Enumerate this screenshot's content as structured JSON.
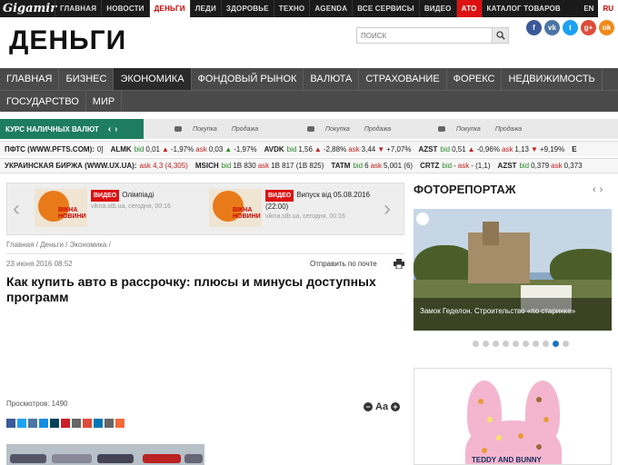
{
  "topbar": {
    "logo": "Gigamir",
    "items": [
      "ГЛАВНАЯ",
      "НОВОСТИ",
      "ДЕНЬГИ",
      "ЛЕДИ",
      "ЗДОРОВЬЕ",
      "ТЕХНО",
      "AGENDA",
      "ВСЕ СЕРВИСЫ",
      "ВИДЕО",
      "АТО",
      "КАТАЛОГ ТОВАРОВ"
    ],
    "active": "ДЕНЬГИ",
    "highlight": "АТО",
    "langs": [
      "EN",
      "RU"
    ],
    "lang_active": "RU"
  },
  "header": {
    "brand": "ДЕНЬГИ",
    "search_placeholder": "ПОИСК",
    "social": [
      {
        "icon": "facebook-icon",
        "glyph": "f",
        "color": "#3b5998"
      },
      {
        "icon": "vk-icon",
        "glyph": "vk",
        "color": "#4c75a3"
      },
      {
        "icon": "twitter-icon",
        "glyph": "t",
        "color": "#1da1f2"
      },
      {
        "icon": "google-plus-icon",
        "glyph": "g+",
        "color": "#dd4b39"
      },
      {
        "icon": "odnoklassniki-icon",
        "glyph": "ok",
        "color": "#f28a1a"
      }
    ]
  },
  "mainnav": {
    "row1": [
      "ГЛАВНАЯ",
      "БИЗНЕС",
      "ЭКОНОМИКА",
      "ФОНДОВЫЙ РЫНОК",
      "ВАЛЮТА",
      "СТРАХОВАНИЕ",
      "ФОРЕКС",
      "НЕДВИЖИМОСТЬ"
    ],
    "row2": [
      "ГОСУДАРСТВО",
      "МИР"
    ],
    "active": "ЭКОНОМИКА"
  },
  "currency": {
    "tab": "КУРС НАЛИЧНЫХ ВАЛЮТ",
    "buy": "Покупка",
    "sell": "Продажа"
  },
  "ticker1": {
    "source": "ПФТС (WWW.PFTS.COM):",
    "lead": "0]",
    "items": [
      {
        "t": "ALMK",
        "bid": "0,01",
        "bidch": "-1,97%",
        "ask": "0,03",
        "askch": "-1,97%"
      },
      {
        "t": "AVDK",
        "bid": "1,56",
        "bidch": "-2,88%",
        "ask": "3,44",
        "askch": "+7,07%"
      },
      {
        "t": "AZST",
        "bid": "0,51",
        "bidch": "-0,96%",
        "ask": "1,13",
        "askch": "+9,19%"
      }
    ],
    "tail": "E"
  },
  "ticker2": {
    "source": "УКРАИНСКАЯ БИРЖА (WWW.UX.UA):",
    "lead_ask": "ask 4,3 (4,305)",
    "items": [
      {
        "t": "MSICH",
        "bid": "1B 830",
        "ask": "1B 817 (1B 825)"
      },
      {
        "t": "TATM",
        "bid": "6",
        "ask": "5,001 (6)"
      },
      {
        "t": "CRTZ",
        "bid": "-",
        "ask": "- (1,1)"
      },
      {
        "t": "AZST",
        "bid": "0,379",
        "ask": "0,373"
      }
    ],
    "bid_label": "bid",
    "ask_label": "ask"
  },
  "video": {
    "tag": "ВИДЕО",
    "thumb_label": "ВІКНА НОВИНИ",
    "items": [
      {
        "title": "Олімпіаді",
        "source": "vikna.stb.ua, сегодня, 00:16"
      },
      {
        "title": "Випуск від 05.08.2016 (22:00)",
        "source": "vikna.stb.ua, сегодня, 00:16"
      }
    ]
  },
  "article": {
    "breadcrumb": "Главная / Деньги / Экономика /",
    "date": "23 июня 2016 08:52",
    "mail": "Отправить по почте",
    "title": "Как купить авто в рассрочку: плюсы и минусы доступных программ",
    "views": "Просмотров: 1490",
    "font_label": "Aa",
    "share": [
      {
        "icon": "facebook-share-icon",
        "color": "#3b5998"
      },
      {
        "icon": "twitter-share-icon",
        "color": "#1da1f2"
      },
      {
        "icon": "vk-share-icon",
        "color": "#4c75a3"
      },
      {
        "icon": "mail-share-icon",
        "color": "#168de2"
      },
      {
        "icon": "livejournal-share-icon",
        "color": "#004359"
      },
      {
        "icon": "pinterest-share-icon",
        "color": "#cb2027"
      },
      {
        "icon": "email-share-icon",
        "color": "#666666"
      },
      {
        "icon": "google-share-icon",
        "color": "#dd4b39"
      },
      {
        "icon": "linkedin-share-icon",
        "color": "#0077b5"
      },
      {
        "icon": "print-share-icon",
        "color": "#666666"
      },
      {
        "icon": "more-share-icon",
        "color": "#f16a3a"
      }
    ]
  },
  "photo": {
    "title": "ФОТОРЕПОРТАЖ",
    "caption": "Замок Геделон. Строительство «по старинке»",
    "dots": 10,
    "active_dot": 8
  },
  "ad": {
    "text": "TEDDY AND BUNNY"
  }
}
